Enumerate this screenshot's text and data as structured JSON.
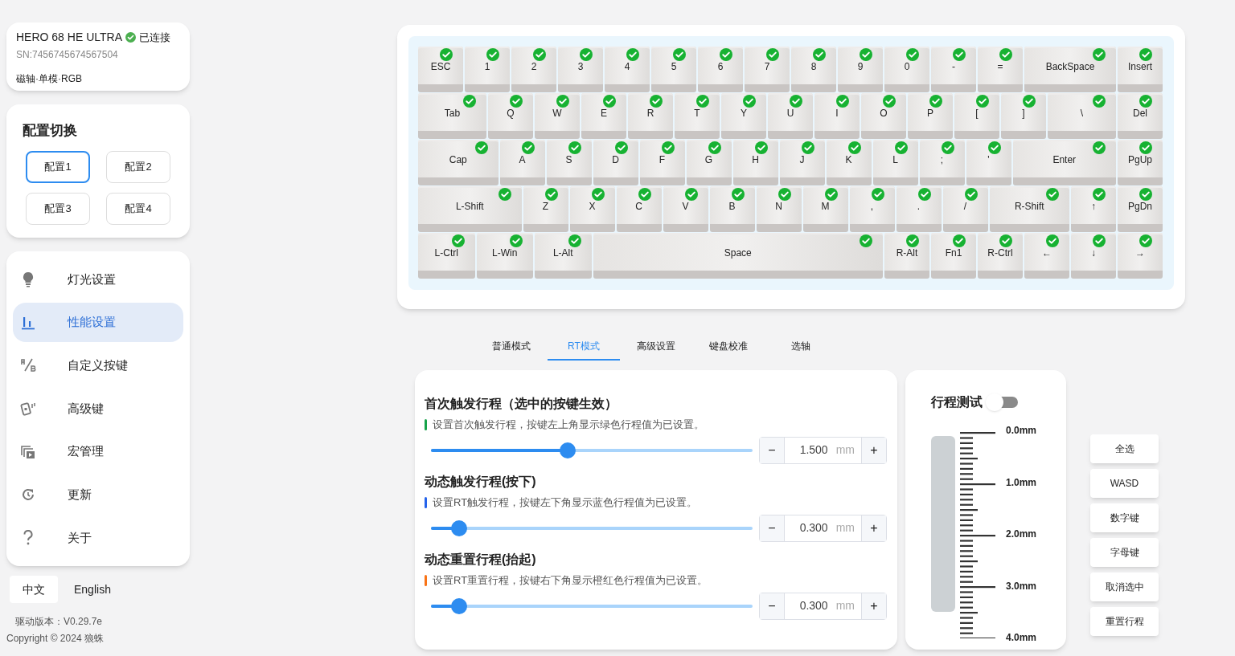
{
  "device": {
    "name": "HERO 68 HE ULTRA",
    "connected": true,
    "status": "已连接",
    "serial": "SN:7456745674567504",
    "tags": "磁轴·单模·RGB"
  },
  "profiles": {
    "title": "配置切换",
    "items": [
      {
        "label": "配置1",
        "selected": true
      },
      {
        "label": "配置2",
        "selected": false
      },
      {
        "label": "配置3",
        "selected": false
      },
      {
        "label": "配置4",
        "selected": false
      }
    ]
  },
  "menu": [
    {
      "label": "灯光设置",
      "kind": "bulb",
      "selected": false
    },
    {
      "label": "性能设置",
      "kind": "bars",
      "selected": true
    },
    {
      "label": "自定义按键",
      "kind": "ab",
      "selected": false
    },
    {
      "label": "高级键",
      "kind": "card",
      "selected": false
    },
    {
      "label": "宏管理",
      "kind": "macro",
      "selected": false
    },
    {
      "label": "更新",
      "kind": "update",
      "selected": false
    },
    {
      "label": "关于",
      "kind": "help",
      "selected": false
    }
  ],
  "languages": [
    {
      "label": "中文",
      "selected": true
    },
    {
      "label": "English",
      "selected": false
    }
  ],
  "version": "驱动版本：V0.29.7e",
  "copyright": "Copyright © 2024 狼蛛",
  "keyboard": {
    "rows": [
      {
        "keys": [
          {
            "label": "ESC",
            "checked": true
          },
          {
            "label": "1",
            "checked": true
          },
          {
            "label": "2",
            "checked": true
          },
          {
            "label": "3",
            "checked": true
          },
          {
            "label": "4",
            "checked": true
          },
          {
            "label": "5",
            "checked": true
          },
          {
            "label": "6",
            "checked": true
          },
          {
            "label": "7",
            "checked": true
          },
          {
            "label": "8",
            "checked": true
          },
          {
            "label": "9",
            "checked": true
          },
          {
            "label": "0",
            "checked": true
          },
          {
            "label": "-",
            "checked": true
          },
          {
            "label": "=",
            "checked": true
          },
          {
            "label": "BackSpace",
            "checked": true
          },
          {
            "label": "Insert",
            "checked": true
          }
        ]
      },
      {
        "keys": [
          {
            "label": "Tab",
            "checked": true
          },
          {
            "label": "Q",
            "checked": true
          },
          {
            "label": "W",
            "checked": true
          },
          {
            "label": "E",
            "checked": true
          },
          {
            "label": "R",
            "checked": true
          },
          {
            "label": "T",
            "checked": true
          },
          {
            "label": "Y",
            "checked": true
          },
          {
            "label": "U",
            "checked": true
          },
          {
            "label": "I",
            "checked": true
          },
          {
            "label": "O",
            "checked": true
          },
          {
            "label": "P",
            "checked": true
          },
          {
            "label": "[",
            "checked": true
          },
          {
            "label": "]",
            "checked": true
          },
          {
            "label": "\\",
            "checked": true
          },
          {
            "label": "Del",
            "checked": true
          }
        ]
      },
      {
        "keys": [
          {
            "label": "Cap",
            "checked": true
          },
          {
            "label": "A",
            "checked": true
          },
          {
            "label": "S",
            "checked": true
          },
          {
            "label": "D",
            "checked": true
          },
          {
            "label": "F",
            "checked": true
          },
          {
            "label": "G",
            "checked": true
          },
          {
            "label": "H",
            "checked": true
          },
          {
            "label": "J",
            "checked": true
          },
          {
            "label": "K",
            "checked": true
          },
          {
            "label": "L",
            "checked": true
          },
          {
            "label": ";",
            "checked": true
          },
          {
            "label": "'",
            "checked": true
          },
          {
            "label": "Enter",
            "checked": true
          },
          {
            "label": "PgUp",
            "checked": true
          }
        ]
      },
      {
        "keys": [
          {
            "label": "L-Shift",
            "checked": true
          },
          {
            "label": "Z",
            "checked": true
          },
          {
            "label": "X",
            "checked": true
          },
          {
            "label": "C",
            "checked": true
          },
          {
            "label": "V",
            "checked": true
          },
          {
            "label": "B",
            "checked": true
          },
          {
            "label": "N",
            "checked": true
          },
          {
            "label": "M",
            "checked": true
          },
          {
            "label": ",",
            "checked": true
          },
          {
            "label": ".",
            "checked": true
          },
          {
            "label": "/",
            "checked": true
          },
          {
            "label": "R-Shift",
            "checked": true
          },
          {
            "label": "↑",
            "checked": true
          },
          {
            "label": "PgDn",
            "checked": true
          }
        ]
      },
      {
        "keys": [
          {
            "label": "L-Ctrl",
            "checked": true
          },
          {
            "label": "L-Win",
            "checked": true
          },
          {
            "label": "L-Alt",
            "checked": true
          },
          {
            "label": "Space",
            "checked": true
          },
          {
            "label": "R-Alt",
            "checked": true
          },
          {
            "label": "Fn1",
            "checked": true
          },
          {
            "label": "R-Ctrl",
            "checked": true
          },
          {
            "label": "←",
            "checked": true
          },
          {
            "label": "↓",
            "checked": true
          },
          {
            "label": "→",
            "checked": true
          }
        ]
      }
    ]
  },
  "tabs": [
    {
      "label": "普通模式",
      "selected": false
    },
    {
      "label": "RT模式",
      "selected": true
    },
    {
      "label": "高级设置",
      "selected": false
    },
    {
      "label": "键盘校准",
      "selected": false
    },
    {
      "label": "选轴",
      "selected": false
    }
  ],
  "settings": [
    {
      "title": "首次触发行程（选中的按键生效）",
      "description": "设置首次触发行程，按键左上角显示绿色行程值为已设置。",
      "color": "#16a34a",
      "level": 0.425,
      "value": "1.500",
      "unit": "mm",
      "minus": "−",
      "plus": "+"
    },
    {
      "title": "动态触发行程(按下)",
      "description": "设置RT触发行程，按键左下角显示蓝色行程值为已设置。",
      "color": "#2563eb",
      "level": 0.0875,
      "value": "0.300",
      "unit": "mm",
      "minus": "−",
      "plus": "+"
    },
    {
      "title": "动态重置行程(抬起)",
      "description": "设置RT重置行程，按键右下角显示橙红色行程值为已设置。",
      "color": "#f97316",
      "level": 0.0875,
      "value": "0.300",
      "unit": "mm",
      "minus": "−",
      "plus": "+"
    }
  ],
  "travel_test": {
    "title": "行程测试",
    "on": false,
    "scale": [
      "0.0mm",
      "1.0mm",
      "2.0mm",
      "3.0mm",
      "4.0mm"
    ]
  },
  "selection_buttons": [
    "全选",
    "WASD",
    "数字键",
    "字母键",
    "取消选中",
    "重置行程"
  ]
}
